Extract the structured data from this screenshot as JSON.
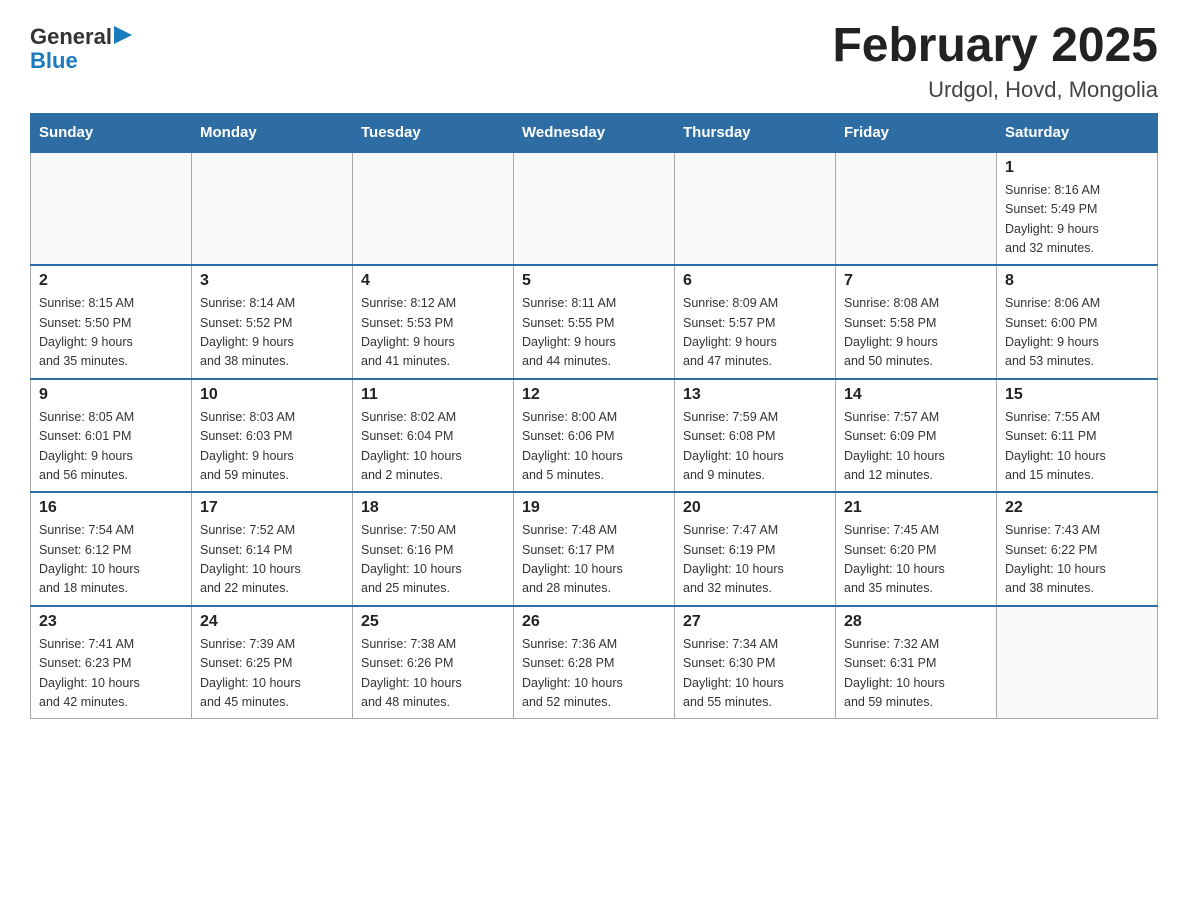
{
  "header": {
    "title": "February 2025",
    "subtitle": "Urdgol, Hovd, Mongolia",
    "logo_general": "General",
    "logo_blue": "Blue"
  },
  "weekdays": [
    "Sunday",
    "Monday",
    "Tuesday",
    "Wednesday",
    "Thursday",
    "Friday",
    "Saturday"
  ],
  "weeks": [
    [
      {
        "day": "",
        "info": ""
      },
      {
        "day": "",
        "info": ""
      },
      {
        "day": "",
        "info": ""
      },
      {
        "day": "",
        "info": ""
      },
      {
        "day": "",
        "info": ""
      },
      {
        "day": "",
        "info": ""
      },
      {
        "day": "1",
        "info": "Sunrise: 8:16 AM\nSunset: 5:49 PM\nDaylight: 9 hours\nand 32 minutes."
      }
    ],
    [
      {
        "day": "2",
        "info": "Sunrise: 8:15 AM\nSunset: 5:50 PM\nDaylight: 9 hours\nand 35 minutes."
      },
      {
        "day": "3",
        "info": "Sunrise: 8:14 AM\nSunset: 5:52 PM\nDaylight: 9 hours\nand 38 minutes."
      },
      {
        "day": "4",
        "info": "Sunrise: 8:12 AM\nSunset: 5:53 PM\nDaylight: 9 hours\nand 41 minutes."
      },
      {
        "day": "5",
        "info": "Sunrise: 8:11 AM\nSunset: 5:55 PM\nDaylight: 9 hours\nand 44 minutes."
      },
      {
        "day": "6",
        "info": "Sunrise: 8:09 AM\nSunset: 5:57 PM\nDaylight: 9 hours\nand 47 minutes."
      },
      {
        "day": "7",
        "info": "Sunrise: 8:08 AM\nSunset: 5:58 PM\nDaylight: 9 hours\nand 50 minutes."
      },
      {
        "day": "8",
        "info": "Sunrise: 8:06 AM\nSunset: 6:00 PM\nDaylight: 9 hours\nand 53 minutes."
      }
    ],
    [
      {
        "day": "9",
        "info": "Sunrise: 8:05 AM\nSunset: 6:01 PM\nDaylight: 9 hours\nand 56 minutes."
      },
      {
        "day": "10",
        "info": "Sunrise: 8:03 AM\nSunset: 6:03 PM\nDaylight: 9 hours\nand 59 minutes."
      },
      {
        "day": "11",
        "info": "Sunrise: 8:02 AM\nSunset: 6:04 PM\nDaylight: 10 hours\nand 2 minutes."
      },
      {
        "day": "12",
        "info": "Sunrise: 8:00 AM\nSunset: 6:06 PM\nDaylight: 10 hours\nand 5 minutes."
      },
      {
        "day": "13",
        "info": "Sunrise: 7:59 AM\nSunset: 6:08 PM\nDaylight: 10 hours\nand 9 minutes."
      },
      {
        "day": "14",
        "info": "Sunrise: 7:57 AM\nSunset: 6:09 PM\nDaylight: 10 hours\nand 12 minutes."
      },
      {
        "day": "15",
        "info": "Sunrise: 7:55 AM\nSunset: 6:11 PM\nDaylight: 10 hours\nand 15 minutes."
      }
    ],
    [
      {
        "day": "16",
        "info": "Sunrise: 7:54 AM\nSunset: 6:12 PM\nDaylight: 10 hours\nand 18 minutes."
      },
      {
        "day": "17",
        "info": "Sunrise: 7:52 AM\nSunset: 6:14 PM\nDaylight: 10 hours\nand 22 minutes."
      },
      {
        "day": "18",
        "info": "Sunrise: 7:50 AM\nSunset: 6:16 PM\nDaylight: 10 hours\nand 25 minutes."
      },
      {
        "day": "19",
        "info": "Sunrise: 7:48 AM\nSunset: 6:17 PM\nDaylight: 10 hours\nand 28 minutes."
      },
      {
        "day": "20",
        "info": "Sunrise: 7:47 AM\nSunset: 6:19 PM\nDaylight: 10 hours\nand 32 minutes."
      },
      {
        "day": "21",
        "info": "Sunrise: 7:45 AM\nSunset: 6:20 PM\nDaylight: 10 hours\nand 35 minutes."
      },
      {
        "day": "22",
        "info": "Sunrise: 7:43 AM\nSunset: 6:22 PM\nDaylight: 10 hours\nand 38 minutes."
      }
    ],
    [
      {
        "day": "23",
        "info": "Sunrise: 7:41 AM\nSunset: 6:23 PM\nDaylight: 10 hours\nand 42 minutes."
      },
      {
        "day": "24",
        "info": "Sunrise: 7:39 AM\nSunset: 6:25 PM\nDaylight: 10 hours\nand 45 minutes."
      },
      {
        "day": "25",
        "info": "Sunrise: 7:38 AM\nSunset: 6:26 PM\nDaylight: 10 hours\nand 48 minutes."
      },
      {
        "day": "26",
        "info": "Sunrise: 7:36 AM\nSunset: 6:28 PM\nDaylight: 10 hours\nand 52 minutes."
      },
      {
        "day": "27",
        "info": "Sunrise: 7:34 AM\nSunset: 6:30 PM\nDaylight: 10 hours\nand 55 minutes."
      },
      {
        "day": "28",
        "info": "Sunrise: 7:32 AM\nSunset: 6:31 PM\nDaylight: 10 hours\nand 59 minutes."
      },
      {
        "day": "",
        "info": ""
      }
    ]
  ]
}
